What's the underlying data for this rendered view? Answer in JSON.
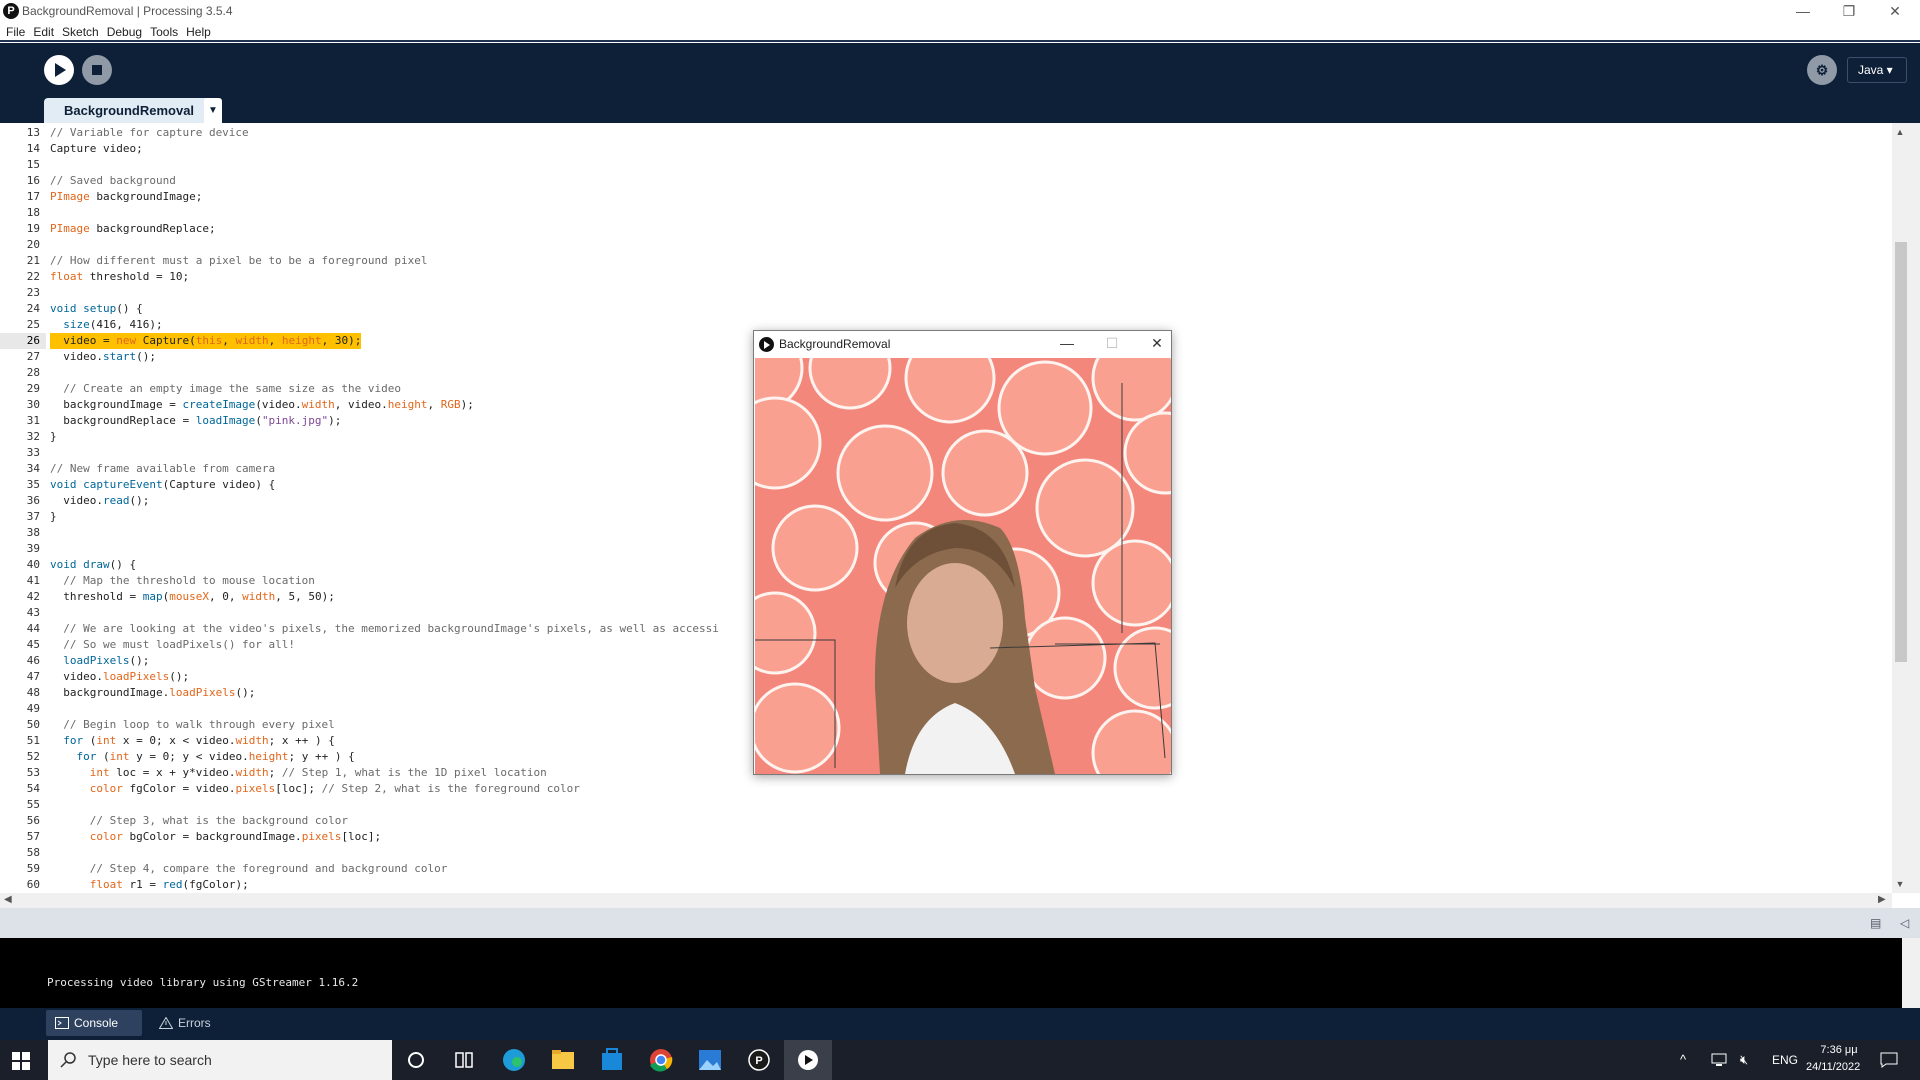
{
  "window": {
    "title": "BackgroundRemoval | Processing 3.5.4",
    "minimize": "—",
    "maximize": "❐",
    "close": "✕"
  },
  "menu": [
    "File",
    "Edit",
    "Sketch",
    "Debug",
    "Tools",
    "Help"
  ],
  "toolbar": {
    "mode": "Java ▾",
    "tab_name": "BackgroundRemoval",
    "tab_menu": "▼"
  },
  "editor": {
    "highlighted_line": 26,
    "lines": [
      {
        "n": "13",
        "code": "// Variable for capture device"
      },
      {
        "n": "14",
        "code": "Capture video;"
      },
      {
        "n": "15",
        "code": ""
      },
      {
        "n": "16",
        "code": "// Saved background"
      },
      {
        "n": "17",
        "code": "PImage backgroundImage;"
      },
      {
        "n": "18",
        "code": ""
      },
      {
        "n": "19",
        "code": "PImage backgroundReplace;"
      },
      {
        "n": "20",
        "code": ""
      },
      {
        "n": "21",
        "code": "// How different must a pixel be to be a foreground pixel"
      },
      {
        "n": "22",
        "code": "float threshold = 10;"
      },
      {
        "n": "23",
        "code": ""
      },
      {
        "n": "24",
        "code": "void setup() {"
      },
      {
        "n": "25",
        "code": "  size(416, 416);"
      },
      {
        "n": "26",
        "code": "  video = new Capture(this, width, height, 30);"
      },
      {
        "n": "27",
        "code": "  video.start();"
      },
      {
        "n": "28",
        "code": ""
      },
      {
        "n": "29",
        "code": "  // Create an empty image the same size as the video"
      },
      {
        "n": "30",
        "code": "  backgroundImage = createImage(video.width, video.height, RGB);"
      },
      {
        "n": "31",
        "code": "  backgroundReplace = loadImage(\"pink.jpg\");"
      },
      {
        "n": "32",
        "code": "}"
      },
      {
        "n": "33",
        "code": ""
      },
      {
        "n": "34",
        "code": "// New frame available from camera"
      },
      {
        "n": "35",
        "code": "void captureEvent(Capture video) {"
      },
      {
        "n": "36",
        "code": "  video.read();"
      },
      {
        "n": "37",
        "code": "}"
      },
      {
        "n": "38",
        "code": ""
      },
      {
        "n": "39",
        "code": ""
      },
      {
        "n": "40",
        "code": "void draw() {"
      },
      {
        "n": "41",
        "code": "  // Map the threshold to mouse location"
      },
      {
        "n": "42",
        "code": "  threshold = map(mouseX, 0, width, 5, 50);"
      },
      {
        "n": "43",
        "code": ""
      },
      {
        "n": "44",
        "code": "  // We are looking at the video's pixels, the memorized backgroundImage's pixels, as well as accessi"
      },
      {
        "n": "45",
        "code": "  // So we must loadPixels() for all!"
      },
      {
        "n": "46",
        "code": "  loadPixels();"
      },
      {
        "n": "47",
        "code": "  video.loadPixels();"
      },
      {
        "n": "48",
        "code": "  backgroundImage.loadPixels();"
      },
      {
        "n": "49",
        "code": ""
      },
      {
        "n": "50",
        "code": "  // Begin loop to walk through every pixel"
      },
      {
        "n": "51",
        "code": "  for (int x = 0; x < video.width; x ++ ) {"
      },
      {
        "n": "52",
        "code": "    for (int y = 0; y < video.height; y ++ ) {"
      },
      {
        "n": "53",
        "code": "      int loc = x + y*video.width; // Step 1, what is the 1D pixel location"
      },
      {
        "n": "54",
        "code": "      color fgColor = video.pixels[loc]; // Step 2, what is the foreground color"
      },
      {
        "n": "55",
        "code": ""
      },
      {
        "n": "56",
        "code": "      // Step 3, what is the background color"
      },
      {
        "n": "57",
        "code": "      color bgColor = backgroundImage.pixels[loc];"
      },
      {
        "n": "58",
        "code": ""
      },
      {
        "n": "59",
        "code": "      // Step 4, compare the foreground and background color"
      },
      {
        "n": "60",
        "code": "      float r1 = red(fgColor);"
      }
    ]
  },
  "console": {
    "output": "Processing video library using GStreamer 1.16.2",
    "tabs": [
      "Console",
      "Errors"
    ]
  },
  "sketch_window": {
    "title": "BackgroundRemoval",
    "minimize": "—",
    "maximize": "☐",
    "close": "✕"
  },
  "taskbar": {
    "search_placeholder": "Type here to search",
    "language": "ENG",
    "time": "7:36 μμ",
    "date": "24/11/2022"
  },
  "colors": {
    "toolbar_bg": "#0e2038",
    "highlight": "#ffc000",
    "comment": "#6a6a6a",
    "keyword": "#e2661a",
    "function": "#006699",
    "string": "#7d4793"
  }
}
